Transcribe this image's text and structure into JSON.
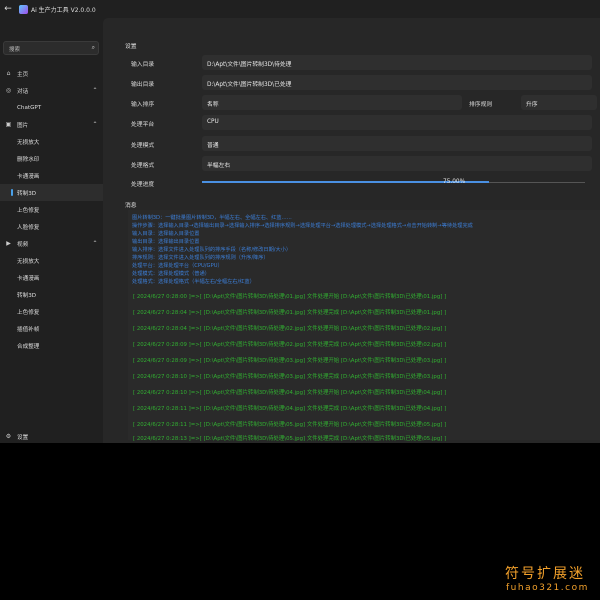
{
  "app": {
    "title": "Ai 生产力工具 V2.0.0.0"
  },
  "sidebar": {
    "search_placeholder": "搜索",
    "items": [
      {
        "label": "主页",
        "icon": "home-icon"
      },
      {
        "label": "对话",
        "icon": "chat-icon"
      },
      {
        "label": "ChatGPT"
      },
      {
        "label": "图片",
        "icon": "image-icon"
      },
      {
        "label": "无损放大"
      },
      {
        "label": "删除水印"
      },
      {
        "label": "卡通漫画"
      },
      {
        "label": "转制3D"
      },
      {
        "label": "上色修复"
      },
      {
        "label": "人脸修复"
      },
      {
        "label": "视频",
        "icon": "video-icon"
      },
      {
        "label": "无损放大"
      },
      {
        "label": "卡通漫画"
      },
      {
        "label": "转制3D"
      },
      {
        "label": "上色修复"
      },
      {
        "label": "插值补帧"
      },
      {
        "label": "合成整理"
      }
    ],
    "settings_label": "设置"
  },
  "main": {
    "section_title": "设置",
    "input_dir_label": "输入目录",
    "input_dir_value": "D:\\Apt\\文件\\图片转制3D\\待处理",
    "output_dir_label": "输出目录",
    "output_dir_value": "D:\\Apt\\文件\\图片转制3D\\已处理",
    "sort_label": "输入排序",
    "sort_value": "名称",
    "sort_rule_label": "排序规则",
    "sort_rule_value": "升序",
    "platform_label": "处理平台",
    "platform_value": "CPU",
    "mode_label": "处理模式",
    "mode_value": "普通",
    "format_label": "处理格式",
    "format_value": "半幅左右",
    "progress_label": "处理进度",
    "progress_value": 0.75,
    "progress_text": "75.00%",
    "messages_title": "消息",
    "help_lines": [
      "图片转制3D：一键批量图片转制3D，半幅左右、全幅左右、红蓝……",
      "操作步骤：选择输入目录→选择输出目录→选择输入排序→选择排序规则→选择处理平台→选择处理模式→选择处理格式→点击开始转制→等待处理完成",
      "输入目录：选择输入目录位置",
      "输出目录：选择输出目录位置",
      "输入排序：选择文件进入处理队列的排序手段（名称/修改日期/大小）",
      "排序规则：选择文件进入处理队列的排序规则（升序/降序）",
      "处理平台：选择处理平台（CPU/GPU）",
      "处理模式：选择处理模式（普通）",
      "处理格式：选择处理格式（半幅左右/全幅左右/红蓝）"
    ],
    "log_lines": [
      "[ 2024/6/27 0:28:00 ]=>[ [D:\\Apt\\文件\\图片转制3D\\待处理\\01.jpg] 文件处理开始 [D:\\Apt\\文件\\图片转制3D\\已处理\\01.jpg] ]",
      "[ 2024/6/27 0:28:04 ]=>[ [D:\\Apt\\文件\\图片转制3D\\待处理\\01.jpg] 文件处理完成 [D:\\Apt\\文件\\图片转制3D\\已处理\\01.jpg] ]",
      "[ 2024/6/27 0:28:04 ]=>[ [D:\\Apt\\文件\\图片转制3D\\待处理\\02.jpg] 文件处理开始 [D:\\Apt\\文件\\图片转制3D\\已处理\\02.jpg] ]",
      "[ 2024/6/27 0:28:09 ]=>[ [D:\\Apt\\文件\\图片转制3D\\待处理\\02.jpg] 文件处理完成 [D:\\Apt\\文件\\图片转制3D\\已处理\\02.jpg] ]",
      "[ 2024/6/27 0:28:09 ]=>[ [D:\\Apt\\文件\\图片转制3D\\待处理\\03.jpg] 文件处理开始 [D:\\Apt\\文件\\图片转制3D\\已处理\\03.jpg] ]",
      "[ 2024/6/27 0:28:10 ]=>[ [D:\\Apt\\文件\\图片转制3D\\待处理\\03.jpg] 文件处理完成 [D:\\Apt\\文件\\图片转制3D\\已处理\\03.jpg] ]",
      "[ 2024/6/27 0:28:10 ]=>[ [D:\\Apt\\文件\\图片转制3D\\待处理\\04.jpg] 文件处理开始 [D:\\Apt\\文件\\图片转制3D\\已处理\\04.jpg] ]",
      "[ 2024/6/27 0:28:11 ]=>[ [D:\\Apt\\文件\\图片转制3D\\待处理\\04.jpg] 文件处理完成 [D:\\Apt\\文件\\图片转制3D\\已处理\\04.jpg] ]",
      "[ 2024/6/27 0:28:11 ]=>[ [D:\\Apt\\文件\\图片转制3D\\待处理\\05.jpg] 文件处理开始 [D:\\Apt\\文件\\图片转制3D\\已处理\\05.jpg] ]",
      "[ 2024/6/27 0:28:13 ]=>[ [D:\\Apt\\文件\\图片转制3D\\待处理\\05.jpg] 文件处理完成 [D:\\Apt\\文件\\图片转制3D\\已处理\\05.jpg] ]"
    ]
  },
  "watermark": {
    "cn": "符号扩展迷",
    "en": "fuhao321.com"
  },
  "colors": {
    "accent": "#4a90e2",
    "help_text": "#3d7fd8",
    "log_text": "#32b032",
    "watermark": "#f3a12b"
  }
}
